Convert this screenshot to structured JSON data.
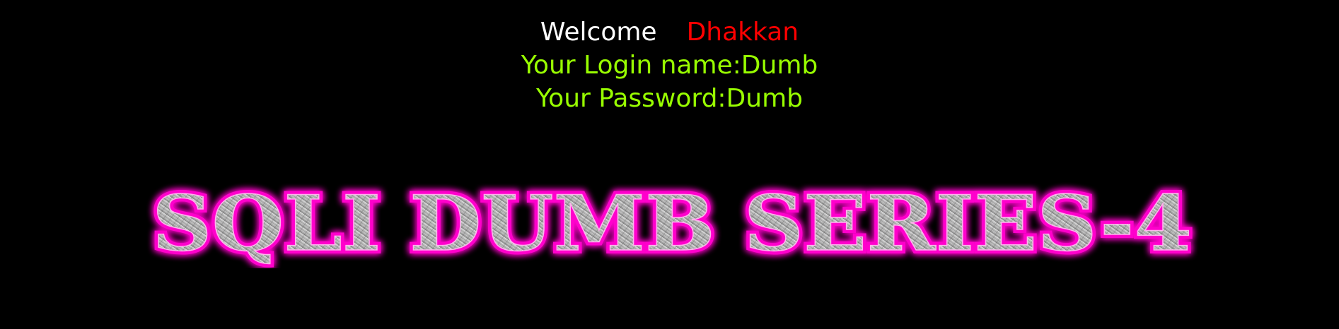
{
  "welcome": {
    "label": "Welcome",
    "username": "Dhakkan"
  },
  "login": {
    "login_line": "Your Login name:Dumb",
    "password_line": "Your Password:Dumb"
  },
  "banner": {
    "text": "SQLI DUMB SERIES-4"
  },
  "colors": {
    "background": "#000000",
    "welcome": "#ffffff",
    "username": "#ff0000",
    "info": "#99ff00",
    "banner_glow": "#ff00cc",
    "banner_fill": "#b0b0b0"
  }
}
